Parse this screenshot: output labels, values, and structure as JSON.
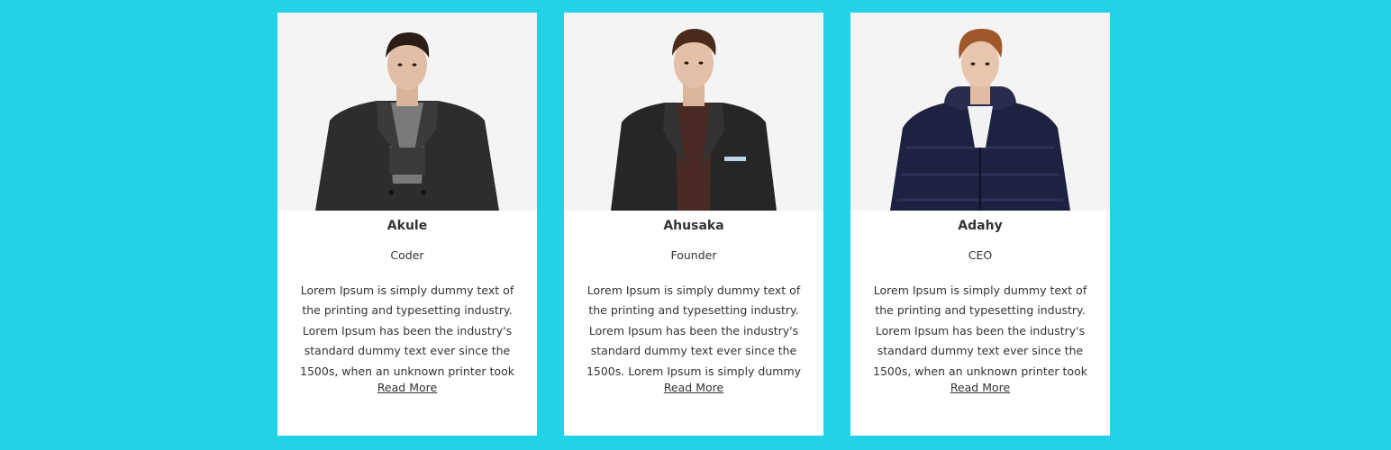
{
  "colors": {
    "page_background": "#22d3e8",
    "card_background": "#ffffff",
    "text": "#333333"
  },
  "team": [
    {
      "name": "Akule",
      "role": "Coder",
      "bio": "Lorem Ipsum is simply dummy text of\nthe printing and typesetting industry.\nLorem Ipsum has been the industry's\nstandard dummy text ever since the\n1500s, when an unknown printer took",
      "read_more": "Read More",
      "photo": "portrait-dark-wool-coat"
    },
    {
      "name": "Ahusaka",
      "role": "Founder",
      "bio": "Lorem Ipsum is simply dummy text of\nthe printing and typesetting industry.\nLorem Ipsum has been the industry's\nstandard dummy text ever since the\n1500s. Lorem Ipsum is simply dummy",
      "read_more": "Read More",
      "photo": "portrait-black-blazer"
    },
    {
      "name": "Adahy",
      "role": "CEO",
      "bio": "Lorem Ipsum is simply dummy text of\nthe printing and typesetting industry.\nLorem Ipsum has been the industry's\nstandard dummy text ever since the\n1500s, when an unknown printer took",
      "read_more": "Read More",
      "photo": "portrait-navy-puffer-jacket"
    }
  ]
}
